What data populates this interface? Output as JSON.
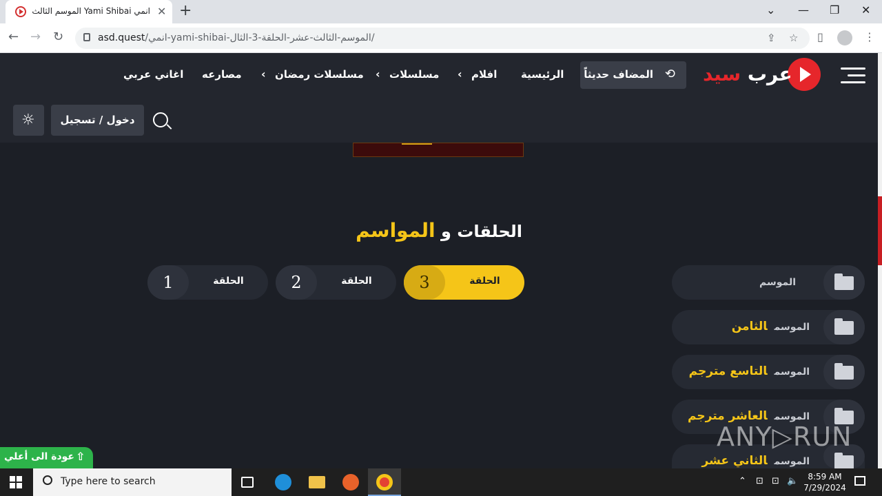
{
  "browser": {
    "tab_title": "انمي Yami Shibai الموسم الثالث عشر",
    "url_host": "asd.quest",
    "url_path": "/انمي-yami-shibai-الموسم-الثالث-عشر-الحلقة-3-الثال/",
    "close_tab": "✕",
    "new_tab": "+",
    "back": "←",
    "forward": "→",
    "reload": "↻",
    "share_icon": "⇪",
    "star_icon": "☆",
    "sidepanel_icon": "▯",
    "menu_icon": "⋮",
    "win_tabsearch": "⌄",
    "win_minimize": "—",
    "win_restore": "❐",
    "win_close": "✕"
  },
  "site": {
    "logo_part1": "عرب",
    "logo_part2": "سيد",
    "recently_added": "المضاف حديثاً",
    "recent_icon": "⟲",
    "nav": [
      "الرئيسية",
      "افلام",
      "مسلسلات",
      "مسلسلات رمضان",
      "مصارعه",
      "اغاني عربي"
    ],
    "chevron": "‹",
    "login": "دخول / تسجيل",
    "theme_icon": "☼"
  },
  "content": {
    "title_part1": "الحلقات و",
    "title_part2": "المواسم",
    "episodes": [
      {
        "number": "3",
        "label": "الحلقة",
        "active": true
      },
      {
        "number": "2",
        "label": "الحلقة",
        "active": false
      },
      {
        "number": "1",
        "label": "الحلقة",
        "active": false
      }
    ],
    "seasons": [
      {
        "label": "الموسم",
        "name": ""
      },
      {
        "label": "الموسم",
        "name": "الثامن"
      },
      {
        "label": "الموسم",
        "name": "التاسع مترجم"
      },
      {
        "label": "الموسم",
        "name": "العاشر مترجم"
      },
      {
        "label": "الموسم",
        "name": "الثاني عشر"
      }
    ],
    "back_to_top": "عودة الى أعلي",
    "back_to_top_icon": "⇧"
  },
  "watermark": "ANY▷RUN",
  "taskbar": {
    "search_placeholder": "Type here to search",
    "time": "8:59 AM",
    "date": "7/29/2024",
    "tray_chevron": "⌃",
    "tray_network": "⊡",
    "tray_volume": "🔈"
  },
  "colors": {
    "accent_yellow": "#f5c518",
    "brand_red": "#e6262b",
    "back_to_top_green": "#2db34a"
  }
}
